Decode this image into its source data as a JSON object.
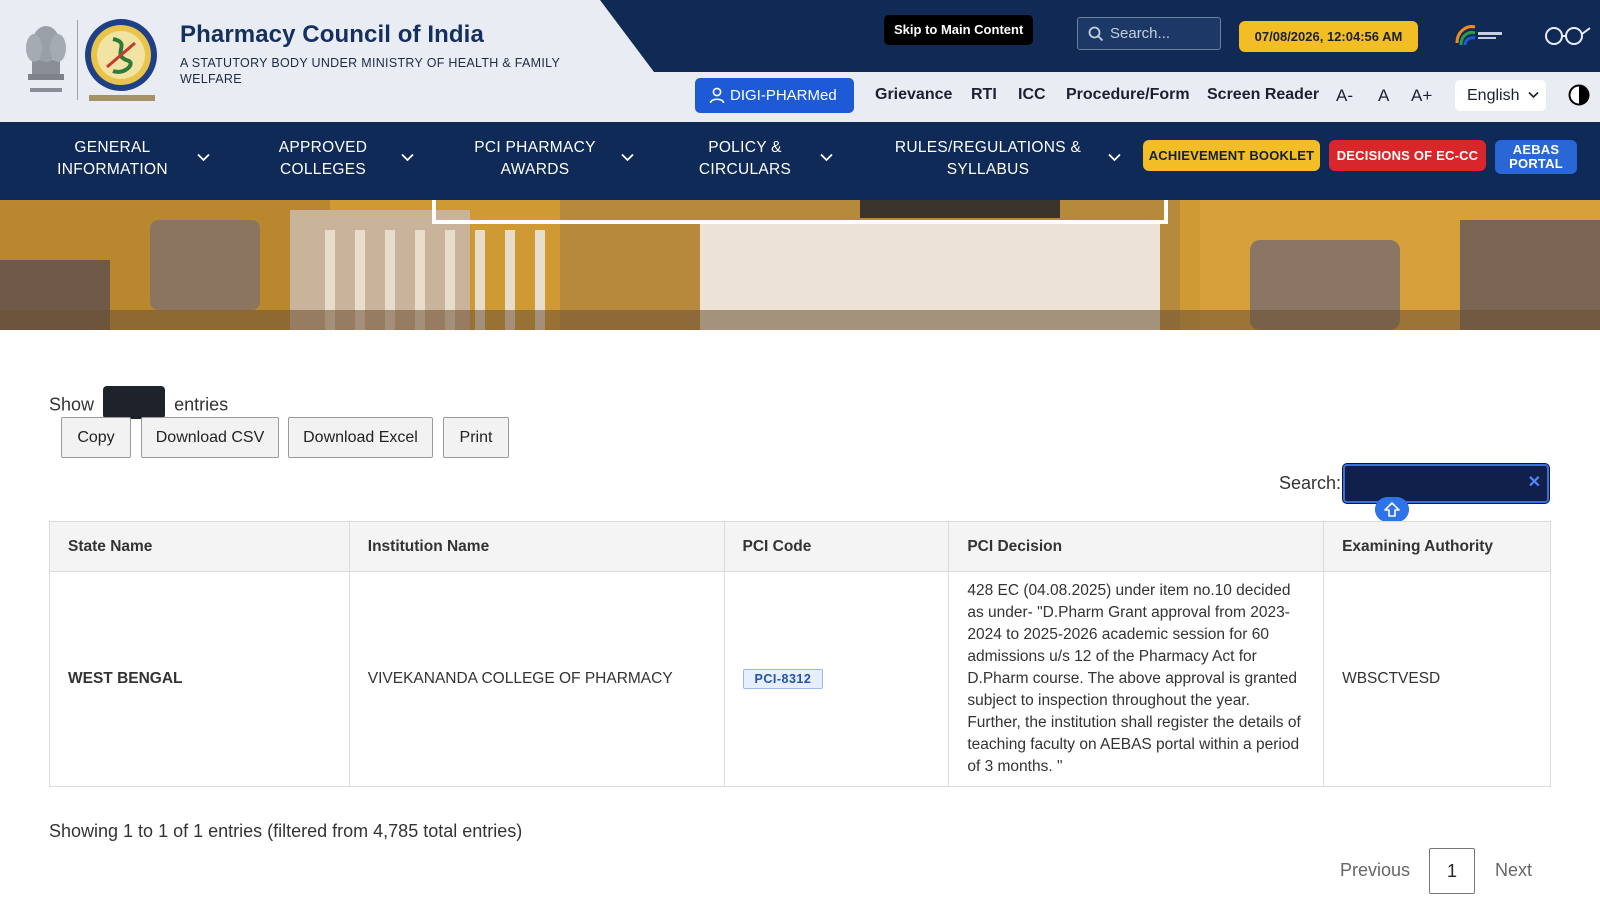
{
  "header": {
    "org_name": "Pharmacy Council of India",
    "org_subtitle": "A STATUTORY BODY UNDER MINISTRY OF HEALTH & FAMILY WELFARE",
    "skip_link": "Skip to Main Content",
    "search_placeholder": "Search...",
    "datetime": "07/08/2026, 12:04:56 AM",
    "digi_pharmed_label": "DIGI-PHARMed",
    "utility_links": [
      "Grievance",
      "RTI",
      "ICC",
      "Procedure/Form",
      "Screen Reader"
    ],
    "font_controls": [
      "A-",
      "A",
      "A+"
    ],
    "language": "English"
  },
  "nav": {
    "items": [
      {
        "line1": "GENERAL",
        "line2": "INFORMATION"
      },
      {
        "line1": "APPROVED",
        "line2": "COLLEGES"
      },
      {
        "line1": "PCI PHARMACY",
        "line2": "AWARDS"
      },
      {
        "line1": "POLICY &",
        "line2": "CIRCULARS"
      },
      {
        "line1": "RULES/REGULATIONS &",
        "line2": "SYLLABUS"
      }
    ],
    "achievement_booklet": "ACHIEVEMENT BOOKLET",
    "decisions": "DECISIONS OF EC-CC",
    "aebas_line1": "AEBAS",
    "aebas_line2": "PORTAL"
  },
  "datatable": {
    "show_label": "Show",
    "entries_label": "entries",
    "buttons": [
      "Copy",
      "Download CSV",
      "Download Excel",
      "Print"
    ],
    "search_label": "Search:",
    "columns": [
      "State Name",
      "Institution Name",
      "PCI Code",
      "PCI Decision",
      "Examining Authority"
    ],
    "rows": [
      {
        "state": "WEST BENGAL",
        "institution": "VIVEKANANDA COLLEGE OF PHARMACY",
        "code": "PCI-8312",
        "decision": "428 EC (04.08.2025) under item no.10 decided as under- \"D.Pharm Grant approval from 2023-2024 to 2025-2026 academic session for 60 admissions u/s 12 of the Pharmacy Act for D.Pharm course. The above approval is granted subject to inspection throughout the year. Further, the institution shall register the details of teaching faculty on AEBAS portal within a period of 3 months. \"",
        "authority": "WBSCTVESD"
      }
    ],
    "info": "Showing 1 to 1 of 1 entries (filtered from 4,785 total entries)",
    "pagination": {
      "previous": "Previous",
      "current": "1",
      "next": "Next"
    }
  },
  "colors": {
    "navy": "#0f2a56",
    "accent_blue": "#1f5ad6",
    "yellow": "#f2bd25",
    "red": "#d9262b"
  },
  "icons": [
    "search-icon",
    "user-icon",
    "chevron-down-icon",
    "contrast-icon",
    "clear-icon",
    "arrow-up-icon"
  ]
}
